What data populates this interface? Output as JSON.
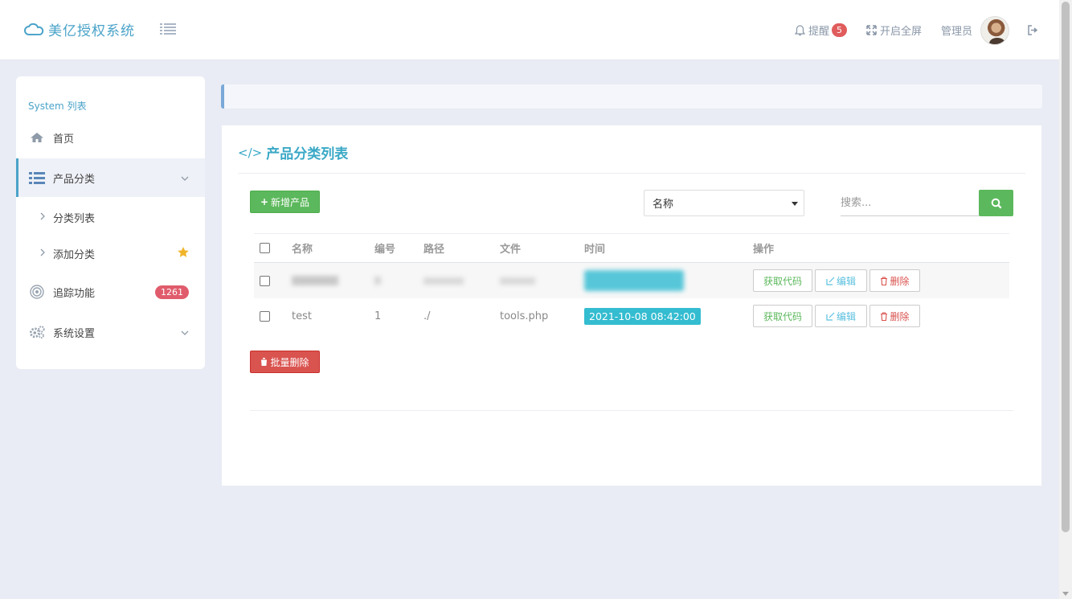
{
  "header": {
    "logo_text": "美亿授权系统",
    "notify_label": "提醒",
    "notify_count": "5",
    "fullscreen_label": "开启全屏",
    "user_label": "管理员"
  },
  "sidebar": {
    "title": "System 列表",
    "items": [
      {
        "label": "首页",
        "icon": "home-icon"
      },
      {
        "label": "产品分类",
        "icon": "list-icon",
        "active": true
      },
      {
        "label": "分类列表"
      },
      {
        "label": "添加分类"
      },
      {
        "label": "追踪功能",
        "icon": "target-icon",
        "badge": "1261"
      },
      {
        "label": "系统设置",
        "icon": "gears-icon"
      }
    ]
  },
  "panel": {
    "title": "产品分类列表",
    "add_button": "新增产品",
    "bulk_delete_button": "批量删除",
    "select_value": "名称",
    "search_placeholder": "搜索..."
  },
  "table": {
    "columns": [
      "名称",
      "编号",
      "路径",
      "文件",
      "时间",
      "操作"
    ],
    "rows": [
      {
        "name": "",
        "id": "",
        "path": "",
        "file": "",
        "time": "",
        "blurred": true
      },
      {
        "name": "test",
        "id": "1",
        "path": "./",
        "file": "tools.php",
        "time": "2021-10-08 08:42:00"
      }
    ],
    "actions": {
      "get_code": "获取代码",
      "edit": "编辑",
      "delete": "删除"
    }
  },
  "colors": {
    "accent": "#3aa8c6",
    "green": "#5cb85c",
    "red": "#d9534f",
    "time_badge": "#34bcd0"
  }
}
